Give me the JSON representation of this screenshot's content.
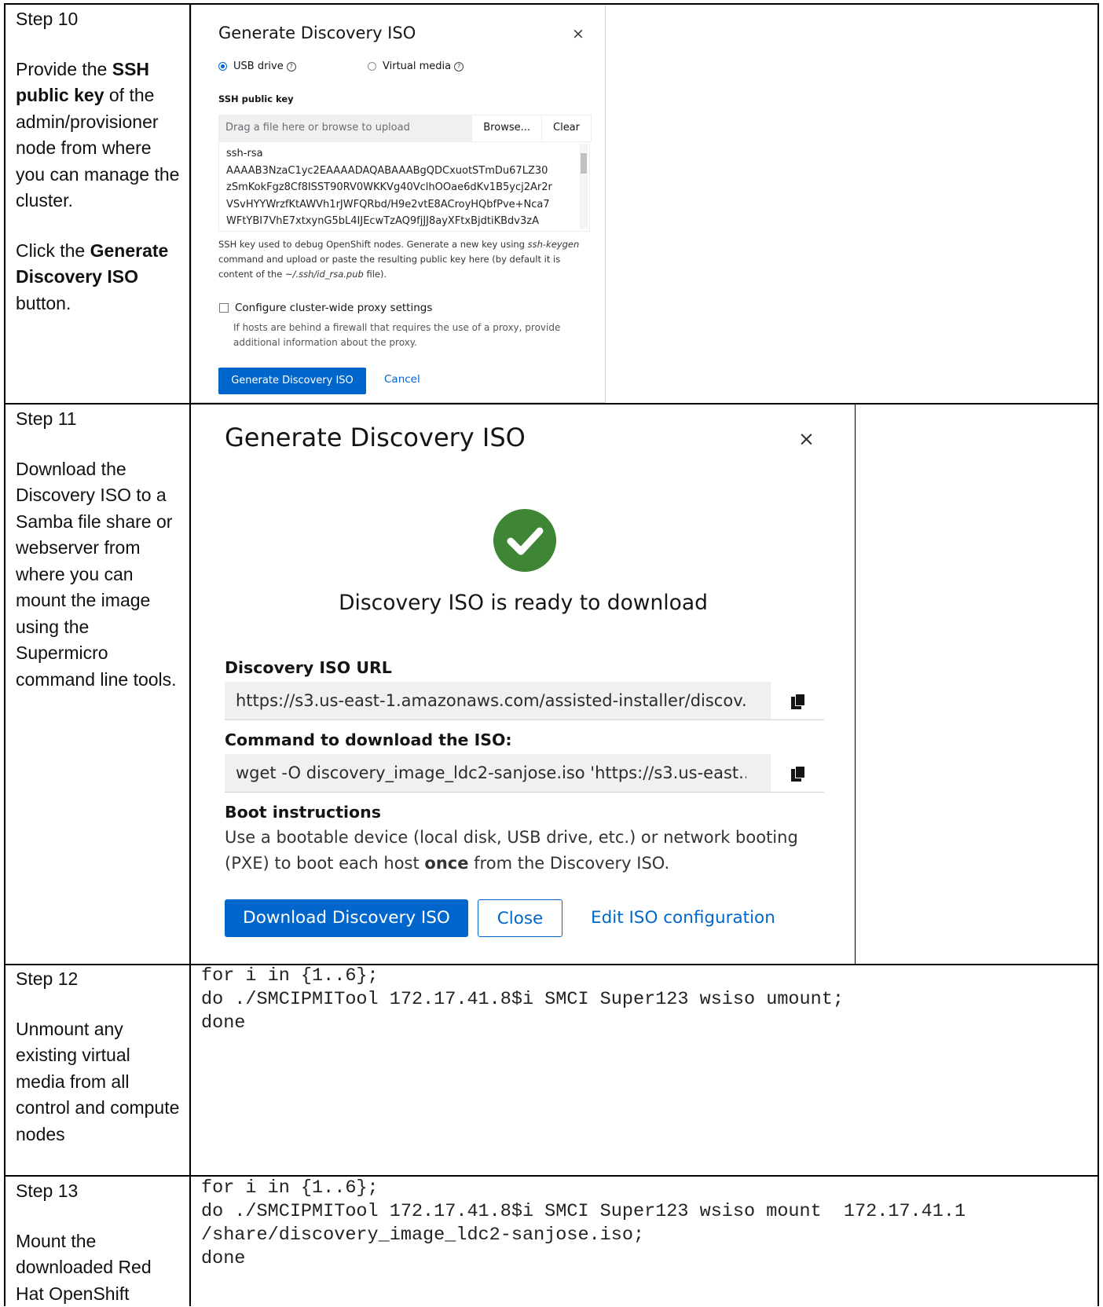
{
  "step10": {
    "step_title": "Step 10",
    "desc_pre": "Provide the ",
    "desc_bold": "SSH public key",
    "desc_post": " of the admin/provisioner node from where you can manage the cluster.",
    "desc2_pre": "Click the ",
    "desc2_bold": "Generate Discovery ISO",
    "desc2_post": " button.",
    "dialog": {
      "title": "Generate Discovery ISO",
      "close": "×",
      "radio_usb": "USB drive",
      "radio_virtual": "Virtual media",
      "ssh_label": "SSH public key",
      "upload_placeholder": "Drag a file here or browse to upload",
      "browse": "Browse...",
      "clear": "Clear",
      "key_lines": [
        "ssh-rsa",
        "AAAAB3NzaC1yc2EAAAADAQABAAABgQDCxuotSTmDu67LZ30",
        "zSmKokFgz8Cf8ISST90RV0WKKVg40VclhOOae6dKv1B5ycj2Ar2r",
        "VSvHYYWrzfKtAWVh1rJWFQRbd/H9e2vtE8ACroyHQbfPve+Nca7",
        "WFtYBI7VhE7xtxynG5bL4IJEcwTzAQ9fjJJ8ayXFtxBjdtiKBdv3zA"
      ],
      "help_pre": "SSH key used to debug OpenShift nodes. Generate a new key using ",
      "help_cmd": "ssh-keygen",
      "help_mid": " command and upload or paste the resulting public key here (by default it is content of the ",
      "help_file": "~/.ssh/id_rsa.pub",
      "help_post": " file).",
      "proxy_label": "Configure cluster-wide proxy settings",
      "proxy_help": "If hosts are behind a firewall that requires the use of a proxy, provide additional information about the proxy.",
      "primary_button": "Generate Discovery ISO",
      "cancel": "Cancel"
    }
  },
  "step11": {
    "step_title": "Step 11",
    "desc": "Download the Discovery ISO to a Samba file share or webserver from where you can mount the image using the Supermicro command line tools.",
    "dialog": {
      "title": "Generate Discovery ISO",
      "close": "×",
      "ready": "Discovery ISO is ready to download",
      "url_label": "Discovery ISO URL",
      "url_value": "https://s3.us-east-1.amazonaws.com/assisted-installer/discov...",
      "cmd_label": "Command to download the ISO:",
      "cmd_value": "wget -O discovery_image_ldc2-sanjose.iso 'https://s3.us-east...",
      "boot_heading": "Boot instructions",
      "boot_pre": "Use a bootable device (local disk, USB drive, etc.) or network booting (PXE) to boot each host ",
      "boot_bold": "once",
      "boot_post": " from the Discovery ISO.",
      "download_button": "Download Discovery ISO",
      "close_button": "Close",
      "edit_link": "Edit ISO configuration"
    }
  },
  "step12": {
    "step_title": "Step 12",
    "desc": "Unmount any existing virtual media from all control and compute nodes",
    "code": "for i in {1..6};\ndo ./SMCIPMITool 172.17.41.8$i SMCI Super123 wsiso umount;\ndone"
  },
  "step13": {
    "step_title": "Step 13",
    "desc": "Mount the downloaded Red Hat OpenShift",
    "code": "for i in {1..6};\ndo ./SMCIPMITool 172.17.41.8$i SMCI Super123 wsiso mount  172.17.41.1\n/share/discovery_image_ldc2-sanjose.iso;\ndone"
  }
}
